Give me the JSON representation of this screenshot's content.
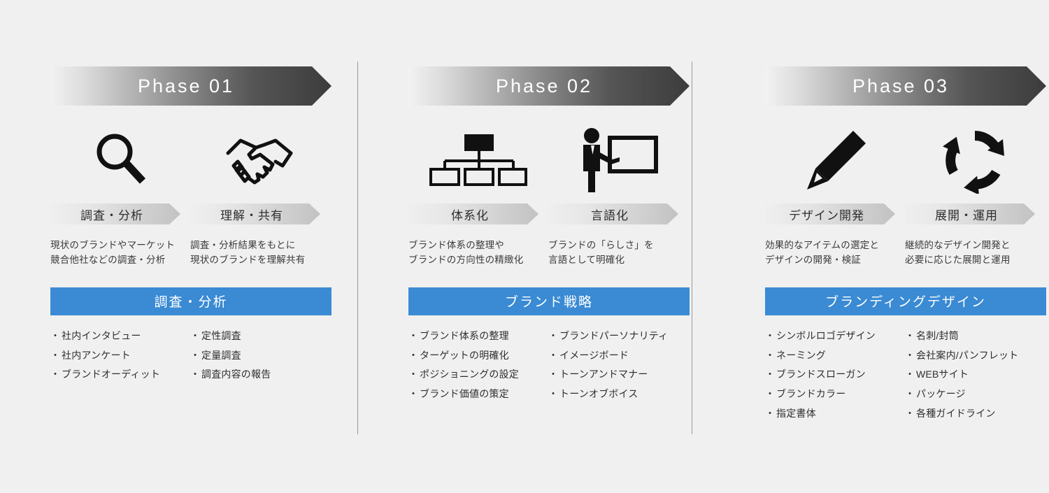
{
  "background_color": "#f0f0f0",
  "accent_color": "#3a8ad4",
  "banner_dark_color": "#3c3c3c",
  "phases": [
    {
      "title": "Phase 01",
      "icons": [
        {
          "name": "magnifier-icon",
          "label": "調査・分析"
        },
        {
          "name": "handshake-icon",
          "label": "理解・共有"
        }
      ],
      "sublabels": [
        "調査・分析",
        "理解・共有"
      ],
      "descriptions": [
        "現状のブランドやマーケット\n競合他社などの調査・分析",
        "調査・分析結果をもとに\n現状のブランドを理解共有"
      ],
      "deliverable_title": "調査・分析",
      "bullets_left": [
        "社内インタビュー",
        "社内アンケート",
        "ブランドオーディット"
      ],
      "bullets_right": [
        "定性調査",
        "定量調査",
        "調査内容の報告"
      ]
    },
    {
      "title": "Phase 02",
      "icons": [
        {
          "name": "org-chart-icon",
          "label": "体系化"
        },
        {
          "name": "presenter-whiteboard-icon",
          "label": "言語化"
        }
      ],
      "sublabels": [
        "体系化",
        "言語化"
      ],
      "descriptions": [
        "ブランド体系の整理や\nブランドの方向性の精緻化",
        "ブランドの「らしさ」を\n言語として明確化"
      ],
      "deliverable_title": "ブランド戦略",
      "bullets_left": [
        "ブランド体系の整理",
        "ターゲットの明確化",
        "ポジショニングの設定",
        "ブランド価値の策定"
      ],
      "bullets_right": [
        "ブランドパーソナリティ",
        "イメージボード",
        "トーンアンドマナー",
        "トーンオブボイス"
      ]
    },
    {
      "title": "Phase 03",
      "icons": [
        {
          "name": "pencil-icon",
          "label": "デザイン開発"
        },
        {
          "name": "cycle-arrows-icon",
          "label": "展開・運用"
        }
      ],
      "sublabels": [
        "デザイン開発",
        "展開・運用"
      ],
      "descriptions": [
        "効果的なアイテムの選定と\nデザインの開発・検証",
        "継続的なデザイン開発と\n必要に応じた展開と運用"
      ],
      "deliverable_title": "ブランディングデザイン",
      "bullets_left": [
        "シンボルロゴデザイン",
        "ネーミング",
        "ブランドスローガン",
        "ブランドカラー",
        "指定書体"
      ],
      "bullets_right": [
        "名刺/封筒",
        "会社案内/パンフレット",
        "WEBサイト",
        "パッケージ",
        "各種ガイドライン"
      ]
    }
  ],
  "bullet_marker": "・"
}
